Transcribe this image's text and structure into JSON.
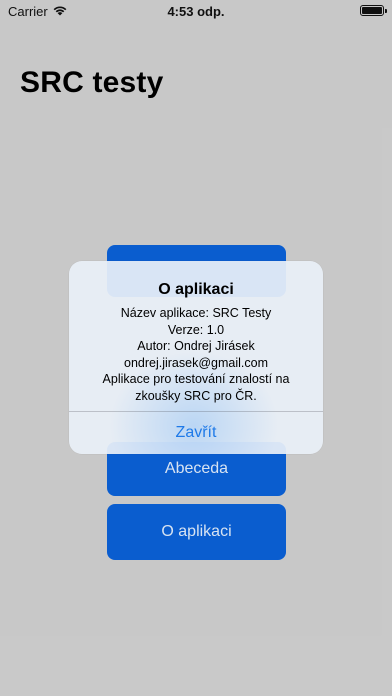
{
  "status_bar": {
    "carrier": "Carrier",
    "time": "4:53 odp."
  },
  "page": {
    "title": "SRC testy"
  },
  "menu": {
    "top_button_label": "",
    "abeceda_label": "Abeceda",
    "o_aplikaci_label": "O aplikaci"
  },
  "alert": {
    "title": "O aplikaci",
    "lines": [
      "Název aplikace: SRC Testy",
      "Verze: 1.0",
      "Autor: Ondrej Jirásek",
      "ondrej.jirasek@gmail.com",
      "Aplikace pro testování znalostí na",
      "zkoušky SRC pro ČR."
    ],
    "action_label": "Zavřít"
  },
  "colors": {
    "background": "#cdcdcd",
    "button": "#0b5fd4",
    "button_text": "#dce8f7",
    "alert_action": "#1f7ae8"
  }
}
